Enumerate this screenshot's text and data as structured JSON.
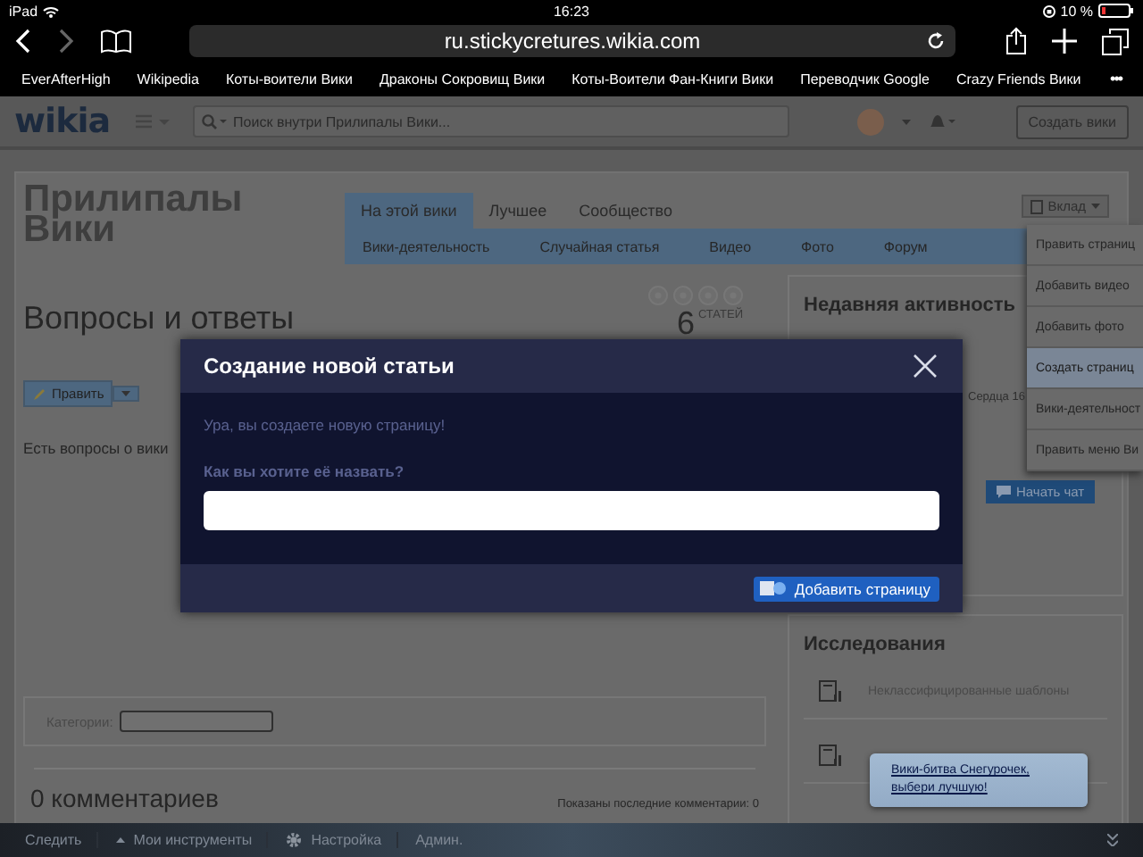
{
  "status_bar": {
    "device": "iPad",
    "time": "16:23",
    "battery": "10 %"
  },
  "browser": {
    "url": "ru.stickycretures.wikia.com",
    "bookmarks": [
      "EverAfterHigh",
      "Wikipedia",
      "Коты-воители Вики",
      "Драконы Сокровищ Вики",
      "Коты-Воители Фан-Книги Вики",
      "Переводчик Google",
      "Crazy Friends Вики"
    ],
    "more": "•••"
  },
  "wikia_header": {
    "logo": "wikia",
    "search": {
      "placeholder": "Поиск внутри Прилипалы Вики..."
    },
    "create_button": "Создать вики"
  },
  "wiki": {
    "title": "Прилипалы Вики",
    "tabs": [
      {
        "label": "На этой вики",
        "selected": true
      },
      {
        "label": "Лучшее",
        "selected": false
      },
      {
        "label": "Сообщество",
        "selected": false
      }
    ],
    "subnav": [
      "Вики-деятельность",
      "Случайная статья",
      "Видео",
      "Фото",
      "Форум"
    ],
    "contribute_button": "Вклад",
    "contribute_menu": [
      {
        "label": "Править страниц",
        "selected": false
      },
      {
        "label": "Добавить видео",
        "selected": false
      },
      {
        "label": "Добавить фото",
        "selected": false
      },
      {
        "label": "Создать страниц",
        "selected": true
      },
      {
        "label": "Вики-деятельност",
        "selected": false
      },
      {
        "label": "Править меню Ви",
        "selected": false
      }
    ]
  },
  "article": {
    "heading": "Вопросы и ответы",
    "edit_button": "Править",
    "intro": "Есть вопросы о вики",
    "categories_label": "Категории:",
    "comments_title": "0 комментариев",
    "comments_note": "Показаны последние комментарии: 0"
  },
  "stats": {
    "count": "6",
    "label": "СТАТЕЙ"
  },
  "rail": {
    "activity_title": "Недавняя активность",
    "activity_snippet": "Сердца 16",
    "chat_button": "Начать чат",
    "explore_title": "Исследования",
    "explore_items": [
      "Неклассифицированные шаблоны"
    ]
  },
  "modal": {
    "title": "Создание новой статьи",
    "message": "Ура, вы создаете новую страницу!",
    "prompt": "Как вы хотите её назвать?",
    "add_button": "Добавить страницу"
  },
  "notification": {
    "text": "Вики-битва Снегурочек, выбери лучшую!"
  },
  "toolbar": {
    "items": [
      {
        "label": "Следить",
        "kind": "plain"
      },
      {
        "label": "Мои инструменты",
        "kind": "menu"
      },
      {
        "label": "Настройка",
        "kind": "settings"
      },
      {
        "label": "Админ.",
        "kind": "plain"
      }
    ]
  }
}
